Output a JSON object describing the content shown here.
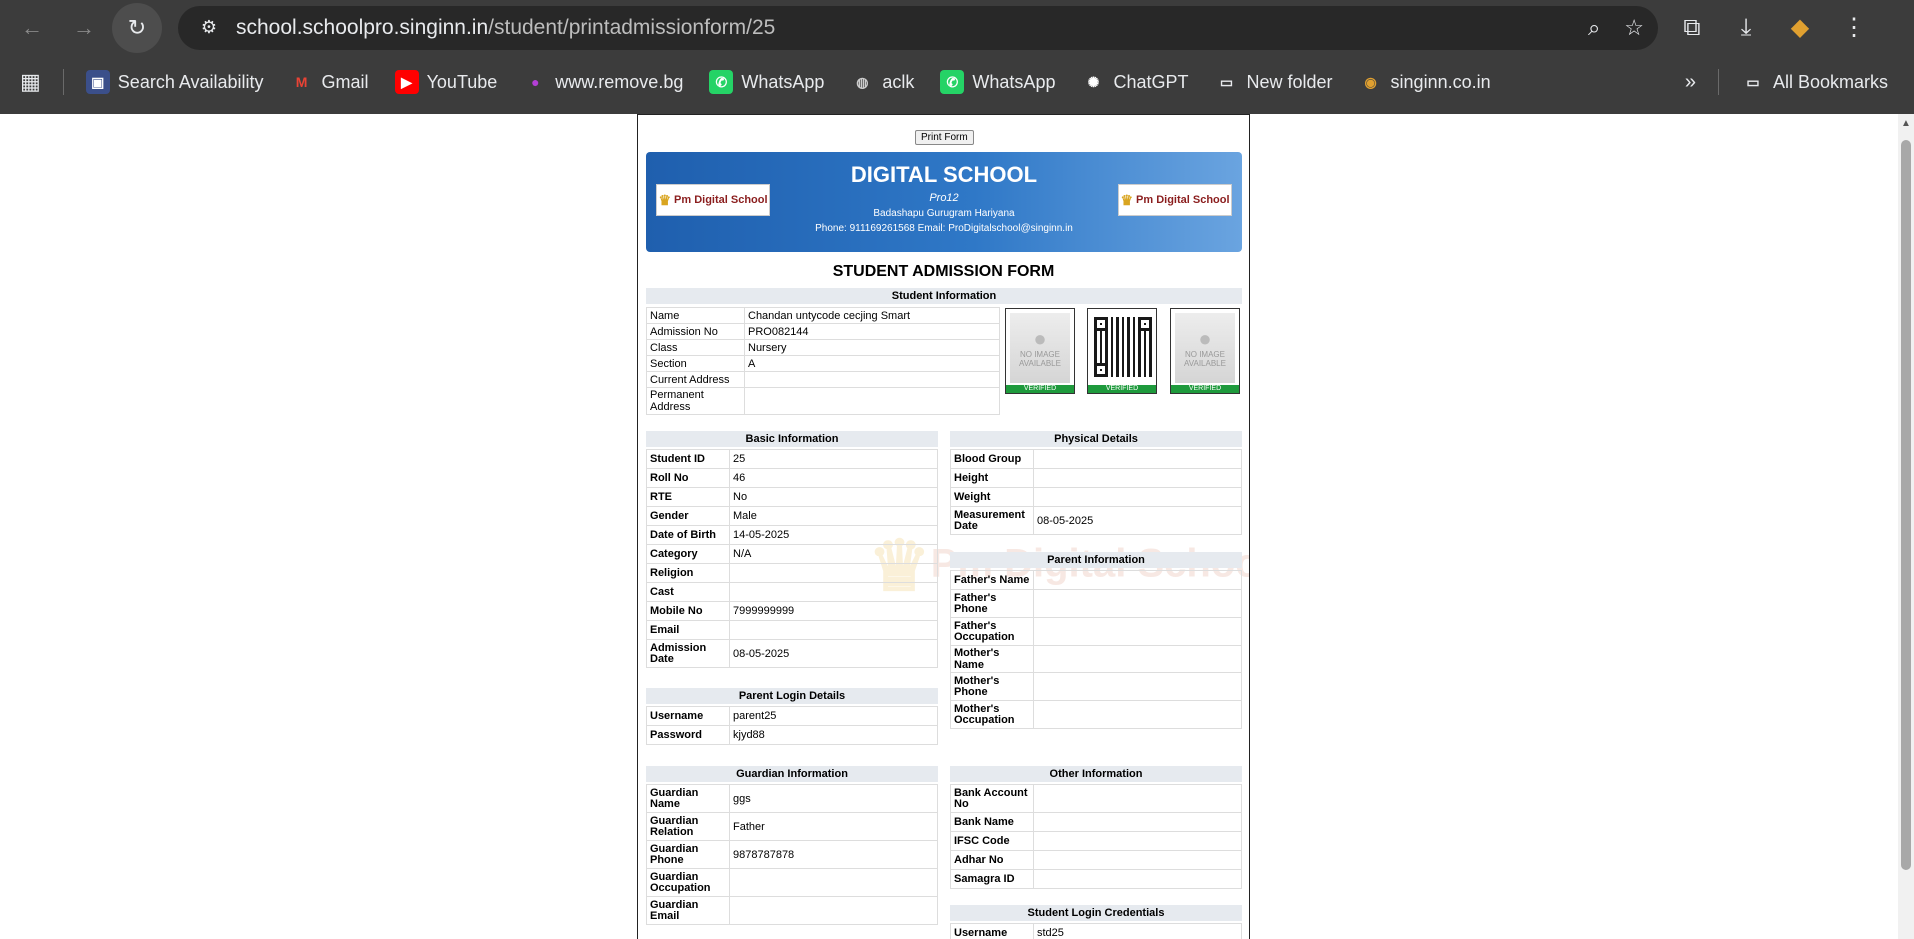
{
  "browser": {
    "url_host": "school.schoolpro.singinn.in",
    "url_path": "/student/printadmissionform/25",
    "bookmarks": [
      {
        "label": "Search Availability",
        "icon": "site-icon"
      },
      {
        "label": "Gmail",
        "icon": "gmail-icon"
      },
      {
        "label": "YouTube",
        "icon": "youtube-icon"
      },
      {
        "label": "www.remove.bg",
        "icon": "removebg-icon"
      },
      {
        "label": "WhatsApp",
        "icon": "whatsapp-icon"
      },
      {
        "label": "aclk",
        "icon": "globe-icon"
      },
      {
        "label": "WhatsApp",
        "icon": "whatsapp-icon"
      },
      {
        "label": "ChatGPT",
        "icon": "chatgpt-icon"
      },
      {
        "label": "New folder",
        "icon": "folder-icon"
      },
      {
        "label": "singinn.co.in",
        "icon": "singinn-icon"
      }
    ],
    "all_bookmarks": "All Bookmarks"
  },
  "form": {
    "print_label": "Print Form",
    "school_name": "DIGITAL SCHOOL",
    "school_code": "Pro12",
    "address": "Badashapu Gurugram Hariyana",
    "contact": "Phone: 911169261568 Email: ProDigitalschool@singinn.in",
    "logo_text": "Pm Digital School",
    "title": "STUDENT ADMISSION FORM",
    "watermark": "Pm Digital School",
    "photo_placeholder": "NO IMAGE",
    "photo_sub": "AVAILABLE",
    "verified": "VERIFIED",
    "student_info": {
      "header": "Student Information",
      "rows": [
        {
          "k": "Name",
          "v": "Chandan untycode cecjing Smart"
        },
        {
          "k": "Admission No",
          "v": "PRO082144"
        },
        {
          "k": "Class",
          "v": "Nursery"
        },
        {
          "k": "Section",
          "v": "A"
        },
        {
          "k": "Current Address",
          "v": ""
        },
        {
          "k": "Permanent Address",
          "v": ""
        }
      ]
    },
    "basic_info": {
      "header": "Basic Information",
      "rows": [
        {
          "k": "Student ID",
          "v": "25"
        },
        {
          "k": "Roll No",
          "v": "46"
        },
        {
          "k": "RTE",
          "v": "No"
        },
        {
          "k": "Gender",
          "v": "Male"
        },
        {
          "k": "Date of Birth",
          "v": "14-05-2025"
        },
        {
          "k": "Category",
          "v": "N/A"
        },
        {
          "k": "Religion",
          "v": ""
        },
        {
          "k": "Cast",
          "v": ""
        },
        {
          "k": "Mobile No",
          "v": "7999999999"
        },
        {
          "k": "Email",
          "v": ""
        },
        {
          "k": "Admission Date",
          "v": "08-05-2025"
        }
      ]
    },
    "parent_login": {
      "header": "Parent Login Details",
      "rows": [
        {
          "k": "Username",
          "v": "parent25"
        },
        {
          "k": "Password",
          "v": "kjyd88"
        }
      ]
    },
    "physical": {
      "header": "Physical Details",
      "rows": [
        {
          "k": "Blood Group",
          "v": ""
        },
        {
          "k": "Height",
          "v": ""
        },
        {
          "k": "Weight",
          "v": ""
        },
        {
          "k": "Measurement Date",
          "v": "08-05-2025"
        }
      ]
    },
    "parent_info": {
      "header": "Parent Information",
      "rows": [
        {
          "k": "Father's Name",
          "v": ""
        },
        {
          "k": "Father's Phone",
          "v": ""
        },
        {
          "k": "Father's Occupation",
          "v": ""
        },
        {
          "k": "Mother's Name",
          "v": ""
        },
        {
          "k": "Mother's Phone",
          "v": ""
        },
        {
          "k": "Mother's Occupation",
          "v": ""
        }
      ]
    },
    "guardian": {
      "header": "Guardian Information",
      "rows": [
        {
          "k": "Guardian Name",
          "v": "ggs"
        },
        {
          "k": "Guardian Relation",
          "v": "Father"
        },
        {
          "k": "Guardian Phone",
          "v": "9878787878"
        },
        {
          "k": "Guardian Occupation",
          "v": ""
        },
        {
          "k": "Guardian Email",
          "v": ""
        }
      ]
    },
    "other": {
      "header": "Other Information",
      "rows": [
        {
          "k": "Bank Account No",
          "v": ""
        },
        {
          "k": "Bank Name",
          "v": ""
        },
        {
          "k": "IFSC Code",
          "v": ""
        },
        {
          "k": "Adhar No",
          "v": ""
        },
        {
          "k": "Samagra ID",
          "v": ""
        }
      ]
    },
    "student_login": {
      "header": "Student Login Credentials",
      "rows": [
        {
          "k": "Username",
          "v": "std25"
        }
      ]
    }
  }
}
